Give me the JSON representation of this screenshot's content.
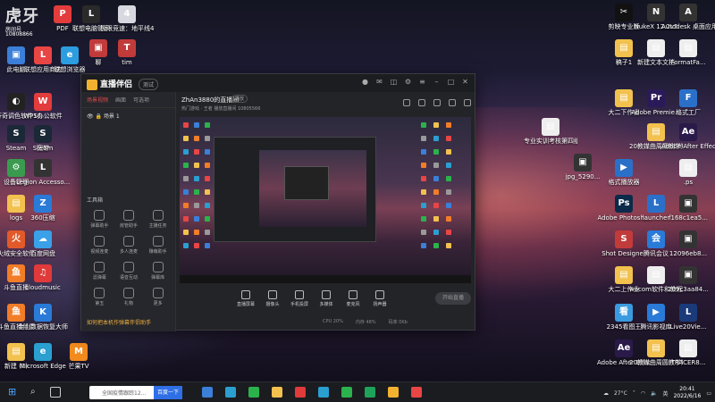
{
  "watermark": {
    "brand": "虎牙",
    "room_label": "房间号",
    "room_number": "10808866"
  },
  "desktop_left": [
    {
      "label": "此电脑",
      "color": "#3b7fd8",
      "glyph": "▣"
    },
    {
      "label": "联想应用商店",
      "color": "#e84545",
      "glyph": "L"
    },
    {
      "label": "联想浏览器",
      "color": "#2c9de0",
      "glyph": "e"
    },
    {
      "label": "达芬奇调色软件16.0",
      "color": "#222",
      "glyph": "◐"
    },
    {
      "label": "WPS办公软件",
      "color": "#e23c3c",
      "glyph": "W"
    },
    {
      "label": "Steam",
      "color": "#1b2838",
      "glyph": "S"
    },
    {
      "label": "宽带",
      "color": "#d23b3b",
      "glyph": "◎"
    },
    {
      "label": "设备管理",
      "color": "#3a9b4e",
      "glyph": "⚙"
    },
    {
      "label": "Legion Accesso...",
      "color": "#333",
      "glyph": "L"
    },
    {
      "label": "Steam",
      "color": "#1b2838",
      "glyph": "S"
    },
    {
      "label": "logs",
      "color": "#f2c14e",
      "glyph": "▤"
    },
    {
      "label": "360压缩",
      "color": "#2a7ad8",
      "glyph": "Z"
    },
    {
      "label": "火绒安全软件",
      "color": "#e25a2a",
      "glyph": "火"
    },
    {
      "label": "百度网盘",
      "color": "#3aa0e8",
      "glyph": "☁"
    },
    {
      "label": "斗鱼直播",
      "color": "#f27d28",
      "glyph": "鱼"
    },
    {
      "label": "cloudmusic",
      "color": "#e03a3a",
      "glyph": "♫"
    },
    {
      "label": "斗鱼直播伴侣",
      "color": "#f27d28",
      "glyph": "鱼"
    },
    {
      "label": "金山数据恢复大师",
      "color": "#2a7ad8",
      "glyph": "K"
    },
    {
      "label": "新建 (2)",
      "color": "#f2c14e",
      "glyph": "▤"
    },
    {
      "label": "Microsoft Edge",
      "color": "#2a9fd0",
      "glyph": "e"
    },
    {
      "label": "芒果TV",
      "color": "#f28a1e",
      "glyph": "M"
    }
  ],
  "desktop_top": [
    {
      "label": "PDF",
      "color": "#e23c3c",
      "glyph": "P"
    },
    {
      "label": "联想电脑管家",
      "color": "#2a2a2a",
      "glyph": "L"
    },
    {
      "label": "极限竞速：地平线4",
      "color": "#d8d8e0",
      "glyph": "4"
    },
    {
      "label": "聊",
      "color": "#c23b3b",
      "glyph": "▣"
    },
    {
      "label": "tim",
      "color": "#c23b3b",
      "glyph": "T"
    }
  ],
  "desktop_right": [
    {
      "label": "剪映专业版",
      "color": "#111",
      "glyph": "✂"
    },
    {
      "label": "NukeX 12.2v5",
      "color": "#333",
      "glyph": "N"
    },
    {
      "label": "Autodesk 桌面应用程序",
      "color": "#333",
      "glyph": "A"
    },
    {
      "label": "稿子1",
      "color": "#f2c14e",
      "glyph": "▤"
    },
    {
      "label": "新建文本文档",
      "color": "#eee",
      "glyph": "▤"
    },
    {
      "label": "FormatFa...",
      "color": "#eee",
      "glyph": "▤"
    },
    {
      "label": "大二下作业",
      "color": "#f2c14e",
      "glyph": "▤"
    },
    {
      "label": "Adobe Premie...",
      "color": "#2b1a5a",
      "glyph": "Pr"
    },
    {
      "label": "格式工厂",
      "color": "#2a70c8",
      "glyph": "F"
    },
    {
      "label": "专业实训考核第四组",
      "color": "#eee",
      "glyph": "▤"
    },
    {
      "label": "20教媒曲周圆教学短片...",
      "color": "#f2c14e",
      "glyph": "▤"
    },
    {
      "label": "Adobe After Effects 2020",
      "color": "#2a1a4a",
      "glyph": "Ae"
    },
    {
      "label": "格式播放器",
      "color": "#2a70c8",
      "glyph": "▶"
    },
    {
      "label": "jpg_5290...",
      "color": "#333",
      "glyph": "▣"
    },
    {
      "label": ".ps",
      "color": "#eee",
      "glyph": "▤"
    },
    {
      "label": "Adobe Photosh...",
      "color": "#0c2a4a",
      "glyph": "Ps"
    },
    {
      "label": "launcher",
      "color": "#2a70c8",
      "glyph": "L"
    },
    {
      "label": "f168c1ea5...",
      "color": "#333",
      "glyph": "▣"
    },
    {
      "label": "Shot Designer",
      "color": "#c23b3b",
      "glyph": "S"
    },
    {
      "label": "腾讯会议",
      "color": "#2a7ad8",
      "glyph": "会"
    },
    {
      "label": "12096eb8...",
      "color": "#333",
      "glyph": "▣"
    },
    {
      "label": "大二上作业",
      "color": "#f2c14e",
      "glyph": "▤"
    },
    {
      "label": "wacom软件和教程",
      "color": "#eee",
      "glyph": "▤"
    },
    {
      "label": "209c3aa84...",
      "color": "#333",
      "glyph": "▣"
    },
    {
      "label": "2345看图王",
      "color": "#3a9be0",
      "glyph": "看"
    },
    {
      "label": "腾讯影视库",
      "color": "#2a7ad8",
      "glyph": "▶"
    },
    {
      "label": "Live20Vie...",
      "color": "#1a3a7a",
      "glyph": "L"
    },
    {
      "label": "Adobe After Effects CC ...",
      "color": "#2a1a4a",
      "glyph": "Ae"
    },
    {
      "label": "20教媒曲周圆教学短片...",
      "color": "#f2c14e",
      "glyph": "▤"
    },
    {
      "label": "TRACER8...",
      "color": "#eee",
      "glyph": "▤"
    }
  ],
  "app": {
    "logo": "直播伴侣",
    "version": "测试",
    "sidebar_tabs": [
      "场景视频",
      "画面",
      "可选项"
    ],
    "scene": "场景 1",
    "tools_header": "工具箱",
    "tools": [
      "弹幕助手",
      "房管助手",
      "主播任务",
      "视频连麦",
      "多人连麦",
      "赚萌助手",
      "滤弹幕",
      "语音互动",
      "弹幕库",
      "第五",
      "礼物",
      "更多"
    ],
    "warning": "如何把本机作弹幕伴侣助手",
    "room_name": "ZhAn3880的直播间",
    "room_tag": "播放",
    "room_sub": "热门游戏 · 王者     播放直播间      10805566",
    "controls": [
      "直播屏幕",
      "摄像头",
      "手机投屏",
      "多媒体",
      "麦克风",
      "扬声器"
    ],
    "go_live": "开始直播",
    "status": [
      "CPU 20%",
      "内存 48%",
      "码率 0Kb"
    ]
  },
  "taskbar": {
    "search_placeholder": "全国疫情跟踪12...",
    "search_button": "百度一下",
    "weather": "27°C",
    "ime": "英",
    "time": "20:41",
    "date": "2022/6/16",
    "app_colors": [
      "#3b7fd8",
      "#2a9fd0",
      "#2bb24c",
      "#f2c14e",
      "#e03a3a",
      "#2a9fd0",
      "#2bb24c",
      "#1fa35a",
      "#f2b230",
      "#e84545"
    ]
  }
}
